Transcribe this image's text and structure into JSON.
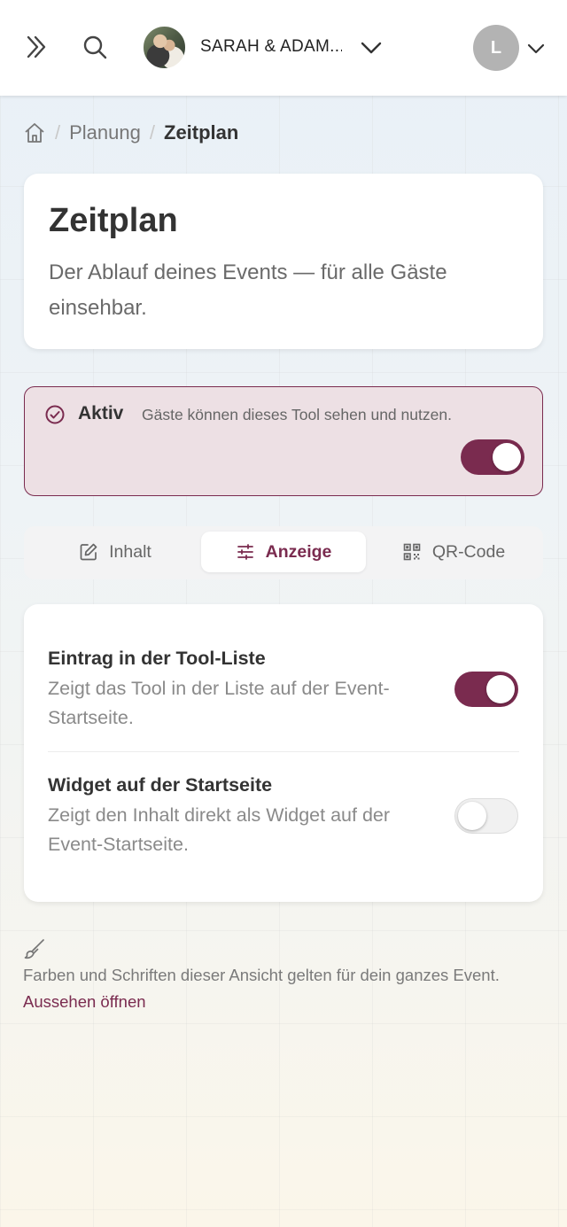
{
  "colors": {
    "accent": "#7a2b4f",
    "active_bg": "#ede0e4",
    "avatar_bg": "#b3b3b3"
  },
  "header": {
    "event_name": "SARAH & ADAM...",
    "user_initial": "L",
    "icons": [
      "chevrons-right-icon",
      "search-icon",
      "chevron-down-icon",
      "chevron-down-icon"
    ]
  },
  "breadcrumb": {
    "home_icon": "home-icon",
    "items": [
      {
        "label": "Planung"
      },
      {
        "label": "Zeitplan"
      }
    ]
  },
  "title_card": {
    "title": "Zeitplan",
    "subtitle": "Der Ablauf deines Events — für alle Gäste einsehbar."
  },
  "active_status": {
    "label": "Aktiv",
    "description": "Gäste können dieses Tool sehen und nutzen.",
    "enabled": true
  },
  "tabs": [
    {
      "label": "Inhalt",
      "icon": "pencil-icon",
      "active": false
    },
    {
      "label": "Anzeige",
      "icon": "sliders-icon",
      "active": true
    },
    {
      "label": "QR-Code",
      "icon": "qr-code-icon",
      "active": false
    }
  ],
  "settings": [
    {
      "title": "Eintrag in der Tool-Liste",
      "description": "Zeigt das Tool in der Liste auf der Event-Startseite.",
      "enabled": true
    },
    {
      "title": "Widget auf der Startseite",
      "description": "Zeigt den Inhalt direkt als Widget auf der Event-Startseite.",
      "enabled": false
    }
  ],
  "footer": {
    "icon": "brush-icon",
    "note": "Farben und Schriften dieser Ansicht gelten für dein ganzes Event.",
    "link_label": "Aussehen öffnen"
  }
}
